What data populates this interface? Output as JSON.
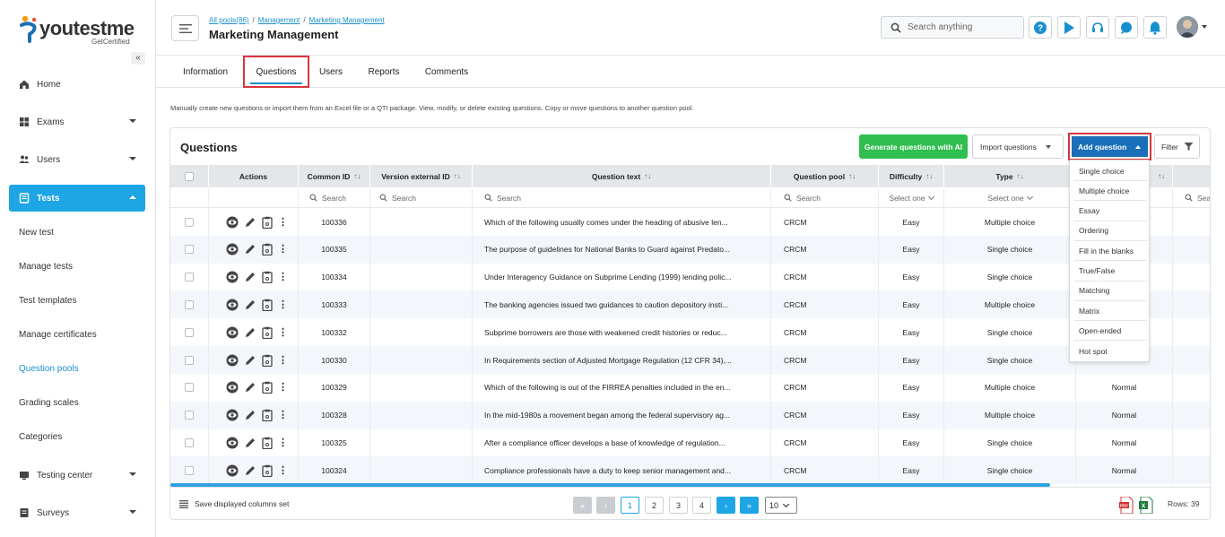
{
  "brand": {
    "name": "youtestme",
    "tagline": "GetCertified",
    "colors": {
      "accent": "#1ea5e6",
      "primary": "#1a6fb8",
      "green": "#2fbe4f",
      "highlight": "#d9363e"
    }
  },
  "sidebar": {
    "items": [
      {
        "label": "Home",
        "icon": "home-icon"
      },
      {
        "label": "Exams",
        "icon": "exams-icon"
      },
      {
        "label": "Users",
        "icon": "users-icon"
      },
      {
        "label": "Tests",
        "icon": "tests-icon"
      },
      {
        "label": "Testing center",
        "icon": "testing-center-icon"
      },
      {
        "label": "Surveys",
        "icon": "surveys-icon"
      }
    ],
    "sub_items": [
      "New test",
      "Manage tests",
      "Test templates",
      "Manage certificates",
      "Question pools",
      "Grading scales",
      "Categories"
    ],
    "current_sub": "Question pools"
  },
  "header": {
    "breadcrumbs": [
      "All pools(86)",
      "Management",
      "Marketing Management"
    ],
    "title": "Marketing Management",
    "search_placeholder": "Search anything"
  },
  "tabs": [
    "Information",
    "Questions",
    "Users",
    "Reports",
    "Comments"
  ],
  "active_tab": "Questions",
  "description": "Manually create new questions or import them from an Excel file or a QTI package. View, modify, or delete existing questions. Copy or move questions to another question pool.",
  "panel": {
    "title": "Questions",
    "generate_label": "Generate questions with AI",
    "import_label": "Import questions",
    "add_label": "Add question",
    "filter_label": "Filter"
  },
  "table": {
    "headers": {
      "actions": "Actions",
      "common_id": "Common ID",
      "version_id": "Version external ID",
      "text": "Question text",
      "pool": "Question pool",
      "difficulty": "Difficulty",
      "type": "Type",
      "sort": "↑↓"
    },
    "filters": {
      "search": "Search",
      "select": "Select one",
      "search_partial": "Sea"
    },
    "rows": [
      {
        "id": "100336",
        "text": "Which of the following usually comes under the heading of abusive len...",
        "pool": "CRCM",
        "difficulty": "Easy",
        "type": "Multiple choice",
        "extra": ""
      },
      {
        "id": "100335",
        "text": "The purpose of guidelines for National Banks to Guard against Predato...",
        "pool": "CRCM",
        "difficulty": "Easy",
        "type": "Single choice",
        "extra": ""
      },
      {
        "id": "100334",
        "text": "Under Interagency Guidance on Subprime Lending (1999) lending polic...",
        "pool": "CRCM",
        "difficulty": "Easy",
        "type": "Single choice",
        "extra": ""
      },
      {
        "id": "100333",
        "text": "The banking agencies issued two guidances to caution depository insti...",
        "pool": "CRCM",
        "difficulty": "Easy",
        "type": "Multiple choice",
        "extra": ""
      },
      {
        "id": "100332",
        "text": "Subprime borrowers are those with weakened credit histories or reduc...",
        "pool": "CRCM",
        "difficulty": "Easy",
        "type": "Single choice",
        "extra": ""
      },
      {
        "id": "100330",
        "text": "In Requirements section of Adjusted Mortgage Regulation (12 CFR 34),...",
        "pool": "CRCM",
        "difficulty": "Easy",
        "type": "Single choice",
        "extra": ""
      },
      {
        "id": "100329",
        "text": "Which of the following is out of the FIRREA penalties included in the en...",
        "pool": "CRCM",
        "difficulty": "Easy",
        "type": "Multiple choice",
        "extra": "Normal"
      },
      {
        "id": "100328",
        "text": "In the mid-1980s a movement began among the federal supervisory ag...",
        "pool": "CRCM",
        "difficulty": "Easy",
        "type": "Multiple choice",
        "extra": "Normal"
      },
      {
        "id": "100325",
        "text": "After a compliance officer develops a base of knowledge of regulation...",
        "pool": "CRCM",
        "difficulty": "Easy",
        "type": "Single choice",
        "extra": "Normal"
      },
      {
        "id": "100324",
        "text": "Compliance professionals have a duty to keep senior management and...",
        "pool": "CRCM",
        "difficulty": "Easy",
        "type": "Single choice",
        "extra": "Normal"
      }
    ]
  },
  "dropdown": [
    "Single choice",
    "Multiple choice",
    "Essay",
    "Ordering",
    "Fill in the blanks",
    "True/False",
    "Matching",
    "Matrix",
    "Open-ended",
    "Hot spot"
  ],
  "footer": {
    "save_label": "Save displayed columns set",
    "pages": [
      "1",
      "2",
      "3",
      "4"
    ],
    "current_page": "1",
    "per_page": "10",
    "rows_label": "Rows: 39"
  }
}
